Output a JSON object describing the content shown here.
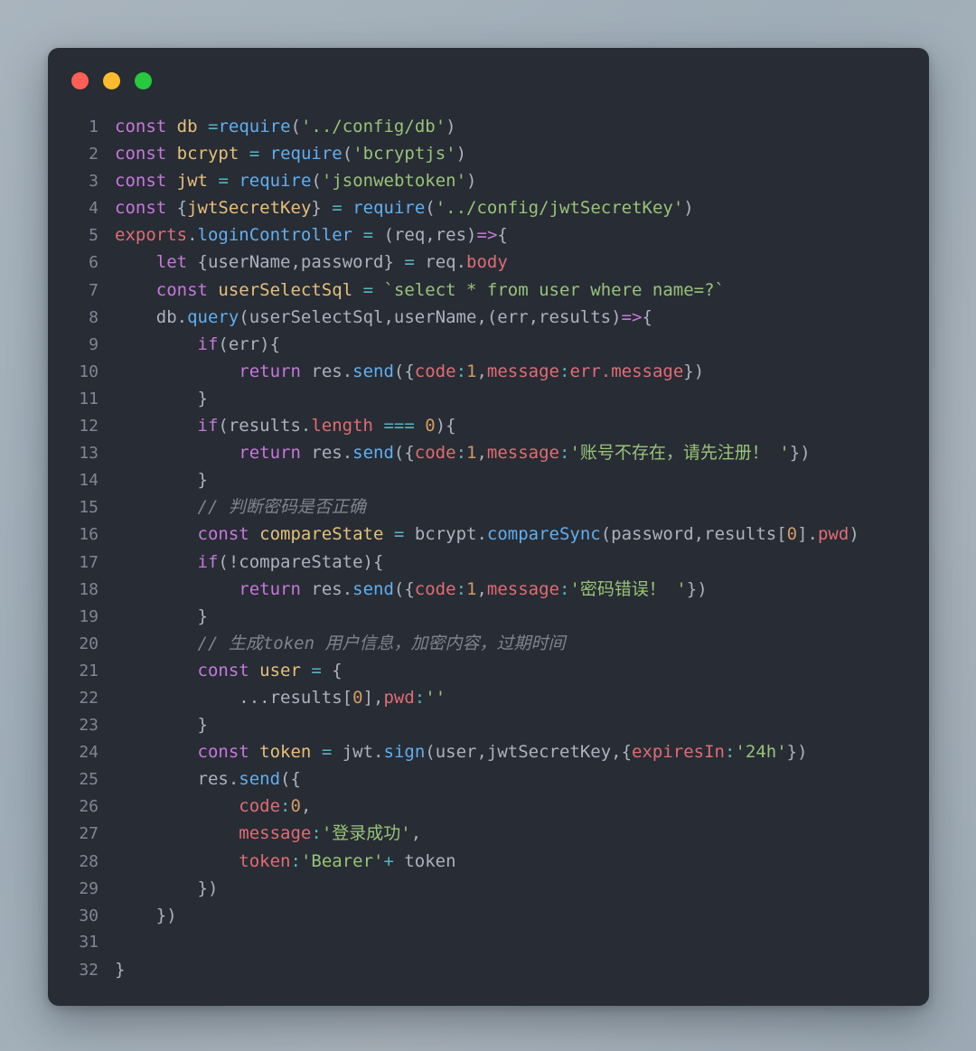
{
  "window": {
    "background_color": "#282c34",
    "page_background_from": "#a9b4bd",
    "page_background_to": "#9ca9b4",
    "traffic_lights": [
      {
        "name": "close",
        "color": "#ff5f56"
      },
      {
        "name": "minimize",
        "color": "#ffbd2e"
      },
      {
        "name": "maximize",
        "color": "#27c93f"
      }
    ]
  },
  "editor": {
    "language": "javascript",
    "theme_colors": {
      "background": "#282c34",
      "foreground": "#abb2bf",
      "line_number": "#7f8794",
      "keyword": "#c678dd",
      "variable": "#e5c07b",
      "function": "#61afef",
      "string": "#98c379",
      "number": "#d19a66",
      "property": "#e06c75",
      "operator": "#56b6c2",
      "comment": "#7f848e"
    },
    "line_numbers": [
      1,
      2,
      3,
      4,
      5,
      6,
      7,
      8,
      9,
      10,
      11,
      12,
      13,
      14,
      15,
      16,
      17,
      18,
      19,
      20,
      21,
      22,
      23,
      24,
      25,
      26,
      27,
      28,
      29,
      30,
      31,
      32
    ],
    "lines": [
      {
        "n": 1,
        "text": "const db =require('../config/db')"
      },
      {
        "n": 2,
        "text": "const bcrypt = require('bcryptjs')"
      },
      {
        "n": 3,
        "text": "const jwt = require('jsonwebtoken')"
      },
      {
        "n": 4,
        "text": "const {jwtSecretKey} = require('../config/jwtSecretKey')"
      },
      {
        "n": 5,
        "text": "exports.loginController = (req,res)=>{"
      },
      {
        "n": 6,
        "text": "    let {userName,password} = req.body"
      },
      {
        "n": 7,
        "text": "    const userSelectSql = `select * from user where name=?`"
      },
      {
        "n": 8,
        "text": "    db.query(userSelectSql,userName,(err,results)=>{"
      },
      {
        "n": 9,
        "text": "        if(err){"
      },
      {
        "n": 10,
        "text": "            return res.send({code:1,message:err.message})"
      },
      {
        "n": 11,
        "text": "        }"
      },
      {
        "n": 12,
        "text": "        if(results.length === 0){"
      },
      {
        "n": 13,
        "text": "            return res.send({code:1,message:'账号不存在，请先注册！ '})"
      },
      {
        "n": 14,
        "text": "        }"
      },
      {
        "n": 15,
        "text": "        // 判断密码是否正确"
      },
      {
        "n": 16,
        "text": "        const compareState = bcrypt.compareSync(password,results[0].pwd)"
      },
      {
        "n": 17,
        "text": "        if(!compareState){"
      },
      {
        "n": 18,
        "text": "            return res.send({code:1,message:'密码错误！ '})"
      },
      {
        "n": 19,
        "text": "        }"
      },
      {
        "n": 20,
        "text": "        // 生成token 用户信息，加密内容，过期时间"
      },
      {
        "n": 21,
        "text": "        const user = {"
      },
      {
        "n": 22,
        "text": "            ...results[0],pwd:''"
      },
      {
        "n": 23,
        "text": "        }"
      },
      {
        "n": 24,
        "text": "        const token = jwt.sign(user,jwtSecretKey,{expiresIn:'24h'})"
      },
      {
        "n": 25,
        "text": "        res.send({"
      },
      {
        "n": 26,
        "text": "            code:0,"
      },
      {
        "n": 27,
        "text": "            message:'登录成功',"
      },
      {
        "n": 28,
        "text": "            token:'Bearer'+ token"
      },
      {
        "n": 29,
        "text": "        })"
      },
      {
        "n": 30,
        "text": "    })"
      },
      {
        "n": 31,
        "text": ""
      },
      {
        "n": 32,
        "text": "}"
      }
    ]
  }
}
